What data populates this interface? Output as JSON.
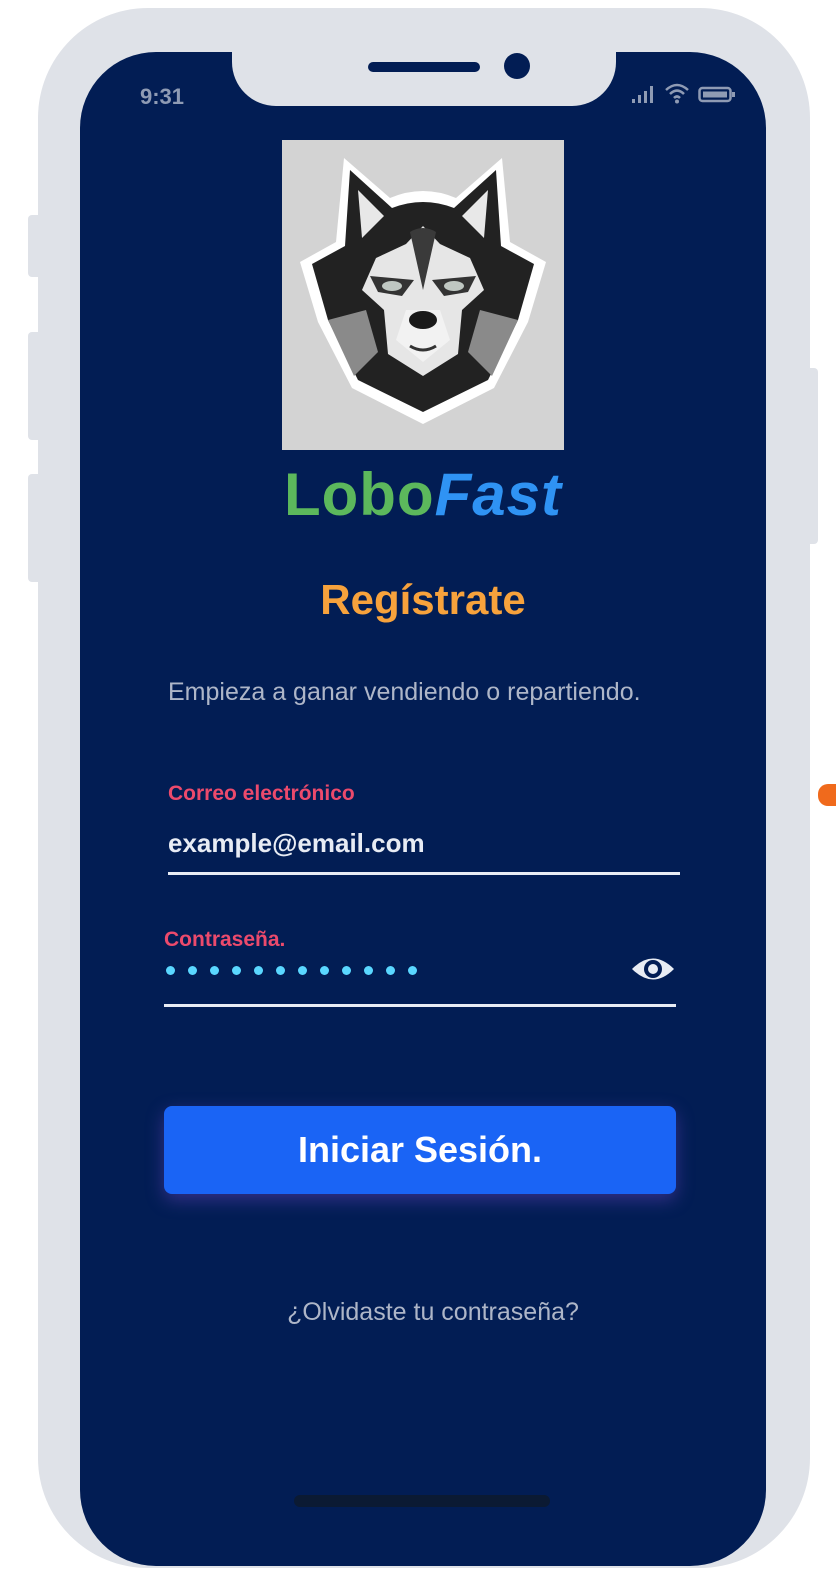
{
  "status_bar": {
    "time": "9:31"
  },
  "brand": {
    "part1": "Lobo",
    "part2": "Fast"
  },
  "form": {
    "title": "Regístrate",
    "subtitle": "Empieza a ganar vendiendo o repartiendo.",
    "email_label": "Correo electrónico",
    "email_value": "example@email.com",
    "password_label": "Contraseña.",
    "password_mask_length": 12,
    "submit_label": "Iniciar Sesión.",
    "forgot_label": "¿Olvidaste tu contraseña?"
  },
  "icons": {
    "logo": "wolf-head-logo",
    "password_toggle": "eye-icon",
    "status": [
      "signal-icon",
      "wifi-icon",
      "battery-icon"
    ]
  },
  "colors": {
    "background": "#021d54",
    "brand_lobo": "#5cb85c",
    "brand_fast": "#2f93f4",
    "title": "#f7a23c",
    "label": "#ec4a6c",
    "button": "#1a64f5",
    "password_dots": "#5ad7ff"
  }
}
